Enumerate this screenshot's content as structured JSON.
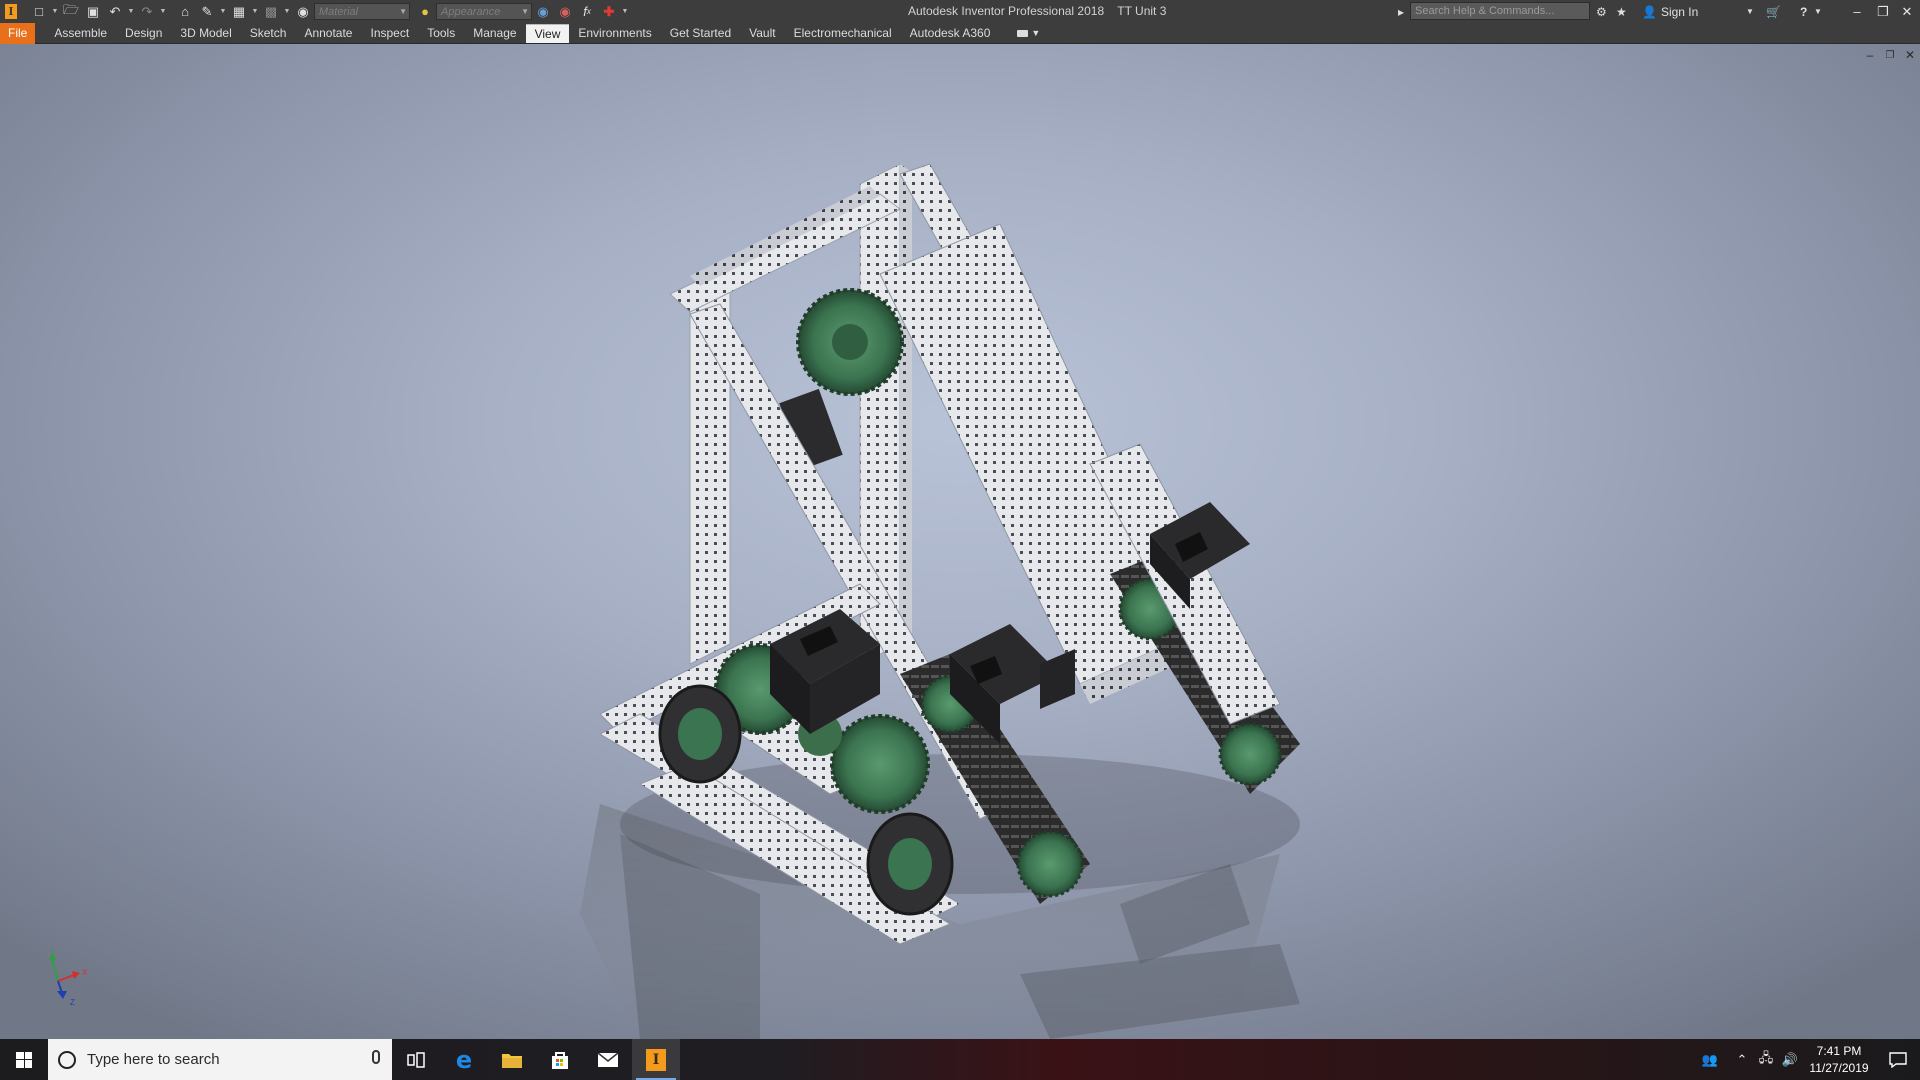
{
  "title_bar": {
    "app_title": "Autodesk Inventor Professional 2018",
    "document_title": "TT Unit 3",
    "material_placeholder": "Material",
    "appearance_placeholder": "Appearance",
    "search_placeholder": "Search Help & Commands...",
    "sign_in_label": "Sign In",
    "logo_letter": "I"
  },
  "ribbon": {
    "tabs": [
      {
        "label": "File"
      },
      {
        "label": "Assemble"
      },
      {
        "label": "Design"
      },
      {
        "label": "3D Model"
      },
      {
        "label": "Sketch"
      },
      {
        "label": "Annotate"
      },
      {
        "label": "Inspect"
      },
      {
        "label": "Tools"
      },
      {
        "label": "Manage"
      },
      {
        "label": "View"
      },
      {
        "label": "Environments"
      },
      {
        "label": "Get Started"
      },
      {
        "label": "Vault"
      },
      {
        "label": "Electromechanical"
      },
      {
        "label": "Autodesk A360"
      }
    ],
    "active_tab": "View"
  },
  "viewport": {
    "triad_labels": {
      "x": "X",
      "y": "Y",
      "z": "Z"
    },
    "colors": {
      "frame": "#e4e6ea",
      "gear": "#3f7a54",
      "motor": "#2a2a2a"
    }
  },
  "taskbar": {
    "search_placeholder": "Type here to search",
    "apps": [
      "task-view",
      "edge",
      "file-explorer",
      "store",
      "mail",
      "inventor"
    ],
    "time": "7:41 PM",
    "date": "11/27/2019"
  }
}
